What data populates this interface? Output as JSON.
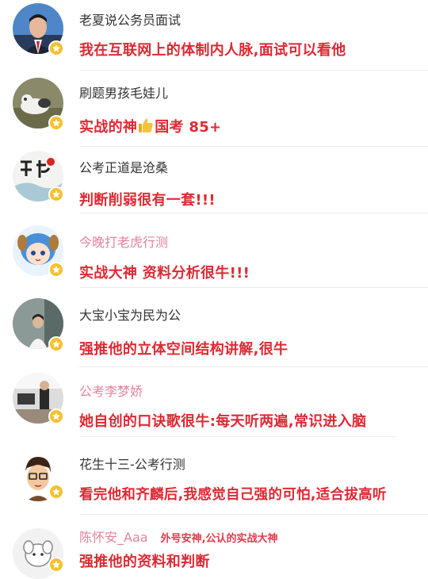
{
  "badge_color": "#f6c02e",
  "comment_color": "#dd2a34",
  "comments": [
    {
      "user": "老夏说公务员面试",
      "text": "我在互联网上的体制内人脉,面试可以看他",
      "icon": "star-badge-icon"
    },
    {
      "user": "刷题男孩毛娃儿",
      "text_before": "实战的神",
      "emoji": "thumbs-up-emoji",
      "text_after": "国考 85+"
    },
    {
      "user": "公考正道是沧桑",
      "text": "判断削弱很有一套!!!"
    },
    {
      "user": "今晚打老虎行测",
      "text": "实战大神 资料分析很牛!!!"
    },
    {
      "user": "大宝小宝为民为公",
      "text": "强推他的立体空间结构讲解,很牛"
    },
    {
      "user": "公考李梦娇",
      "text": "她自创的口诀歌很牛:每天听两遍,常识进入脑"
    },
    {
      "user": "花生十三-公考行测",
      "text": "看完他和齐麟后,我感觉自己强的可怕,适合拔高听"
    },
    {
      "user": "陈怀安_Aaa",
      "tag": "外号安神,公认的实战大神",
      "text": "强推他的资料和判断"
    }
  ]
}
